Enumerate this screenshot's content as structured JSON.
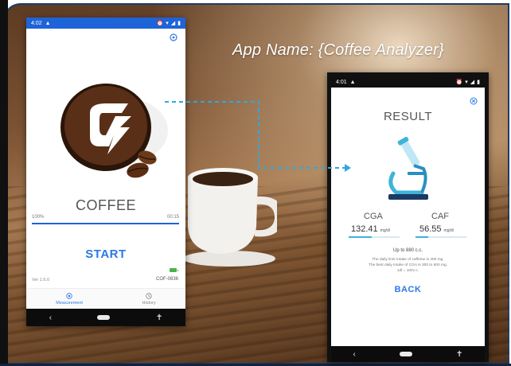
{
  "caption": "App Name: {Coffee Analyzer}",
  "left_phone": {
    "status_time": "4:02",
    "title": "COFFEE",
    "progress_label": "100%",
    "progress_time": "00:15",
    "progress_fraction": 1.0,
    "start_label": "START",
    "version": "Ver 1.6.0",
    "device_id": "COF-0836",
    "bottom_nav": [
      {
        "label": "Measurement",
        "icon": "target-icon",
        "active": true
      },
      {
        "label": "History",
        "icon": "clock-icon",
        "active": false
      }
    ]
  },
  "right_phone": {
    "status_time": "4:01",
    "title": "RESULT",
    "cga_label": "CGA",
    "cga_value": "132.41",
    "cga_unit": "mg/dl",
    "cga_fraction": 0.45,
    "caf_label": "CAF",
    "caf_value": "56.55",
    "caf_unit": "mg/dl",
    "caf_fraction": 0.25,
    "upto_text": "Up to 880 c.c.",
    "note_line1": "The daily limit intake of caffeine is 400 mg.",
    "note_line2": "The best daily intake of CGA is 300 to 600 mg.",
    "note_line3": "1dl = 100c.c.",
    "back_label": "BACK"
  },
  "colors": {
    "status_blue": "#1e63d8",
    "accent_blue": "#2b79e6",
    "logo_brown": "#5a2f17",
    "microscope_blue": "#3fb3d8"
  }
}
